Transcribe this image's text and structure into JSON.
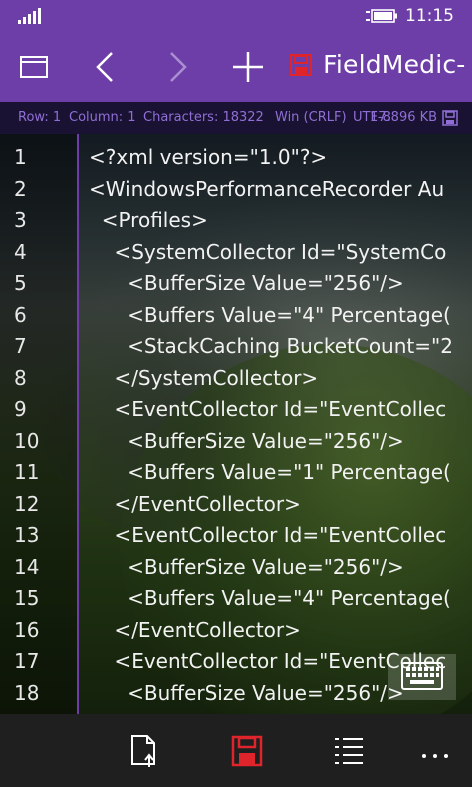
{
  "status_bar": {
    "time": "11:15",
    "signal_icon": "signal-bars-icon",
    "battery_icon": "battery-charging-icon"
  },
  "app_bar": {
    "title": "FieldMedic-",
    "title_icon": "save-disk-icon",
    "buttons": [
      "window-icon",
      "back-arrow-icon",
      "forward-arrow-icon",
      "add-icon"
    ]
  },
  "info_bar": {
    "row": "Row: 1",
    "column": "Column: 1",
    "characters": "Characters: 18322",
    "line_endings": "Win (CRLF)",
    "encoding": "UTF-8",
    "size": "17.896 KB"
  },
  "editor": {
    "lines": [
      {
        "n": "1",
        "text": "<?xml version=\"1.0\"?>"
      },
      {
        "n": "2",
        "text": "<WindowsPerformanceRecorder Au"
      },
      {
        "n": "3",
        "text": "  <Profiles>"
      },
      {
        "n": "4",
        "text": "    <SystemCollector Id=\"SystemCo"
      },
      {
        "n": "5",
        "text": "      <BufferSize Value=\"256\"/>"
      },
      {
        "n": "6",
        "text": "      <Buffers Value=\"4\" Percentage("
      },
      {
        "n": "7",
        "text": "      <StackCaching BucketCount=\"2"
      },
      {
        "n": "8",
        "text": "    </SystemCollector>"
      },
      {
        "n": "9",
        "text": "    <EventCollector Id=\"EventCollec"
      },
      {
        "n": "10",
        "text": "      <BufferSize Value=\"256\"/>"
      },
      {
        "n": "11",
        "text": "      <Buffers Value=\"1\" Percentage("
      },
      {
        "n": "12",
        "text": "    </EventCollector>"
      },
      {
        "n": "13",
        "text": "    <EventCollector Id=\"EventCollec"
      },
      {
        "n": "14",
        "text": "      <BufferSize Value=\"256\"/>"
      },
      {
        "n": "15",
        "text": "      <Buffers Value=\"4\" Percentage("
      },
      {
        "n": "16",
        "text": "    </EventCollector>"
      },
      {
        "n": "17",
        "text": "    <EventCollector Id=\"EventCollec"
      },
      {
        "n": "18",
        "text": "      <BufferSize Value=\"256\"/>"
      }
    ]
  },
  "bottom_bar": {
    "buttons": [
      "open-file-icon",
      "save-icon",
      "list-icon",
      "more-icon"
    ]
  },
  "colors": {
    "accent": "#6e3ea8",
    "save_red": "#e0242c",
    "info_text": "#8f6fd6"
  }
}
